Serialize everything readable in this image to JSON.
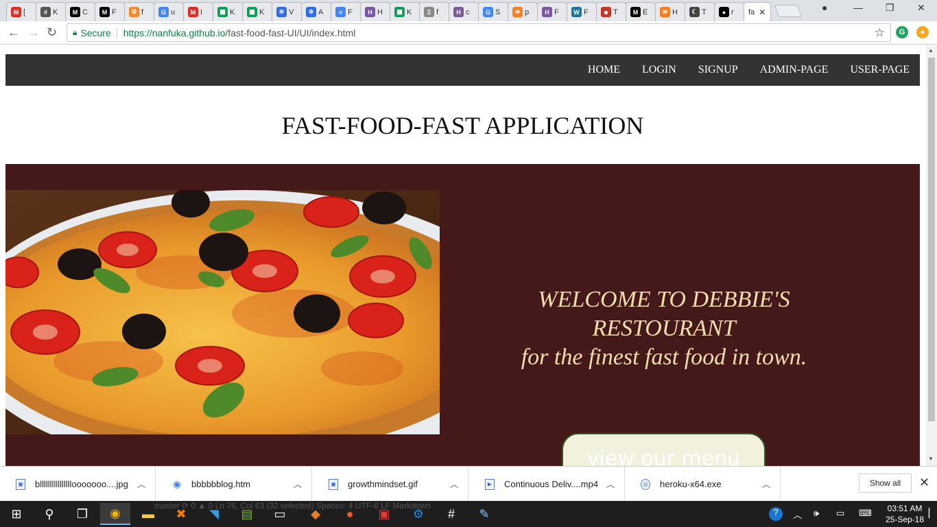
{
  "browser": {
    "tabs": [
      {
        "icon": "gmail-icon",
        "label": "[",
        "color": "#d93025",
        "glyph": "M"
      },
      {
        "icon": "hash-icon",
        "label": "K",
        "color": "#555555",
        "glyph": "#"
      },
      {
        "icon": "medium-icon",
        "label": "C",
        "color": "#000000",
        "glyph": "M"
      },
      {
        "icon": "medium-icon",
        "label": "F",
        "color": "#000000",
        "glyph": "M"
      },
      {
        "icon": "settings-icon",
        "label": "f",
        "color": "#f28b30",
        "glyph": "⚙"
      },
      {
        "icon": "google-icon",
        "label": "u",
        "color": "#4285f4",
        "glyph": "G"
      },
      {
        "icon": "gmail-icon",
        "label": "I",
        "color": "#d93025",
        "glyph": "M"
      },
      {
        "icon": "sheets-icon",
        "label": "K",
        "color": "#0f9d58",
        "glyph": "▦"
      },
      {
        "icon": "sheets-icon",
        "label": "K",
        "color": "#0f9d58",
        "glyph": "▦"
      },
      {
        "icon": "kubernetes-icon",
        "label": "V",
        "color": "#326ce5",
        "glyph": "✲"
      },
      {
        "icon": "kubernetes-icon",
        "label": "A",
        "color": "#326ce5",
        "glyph": "✲"
      },
      {
        "icon": "docs-icon",
        "label": "F",
        "color": "#4285f4",
        "glyph": "≡"
      },
      {
        "icon": "heroku-icon",
        "label": "H",
        "color": "#79589f",
        "glyph": "H"
      },
      {
        "icon": "sheets-icon",
        "label": "K",
        "color": "#0f9d58",
        "glyph": "▦"
      },
      {
        "icon": "page-icon",
        "label": "f",
        "color": "#888888",
        "glyph": "▯"
      },
      {
        "icon": "heroku-icon",
        "label": "c",
        "color": "#79589f",
        "glyph": "H"
      },
      {
        "icon": "google-icon",
        "label": "S",
        "color": "#4285f4",
        "glyph": "G"
      },
      {
        "icon": "stackoverflow-icon",
        "label": "p",
        "color": "#f48024",
        "glyph": "≋"
      },
      {
        "icon": "heroku-icon",
        "label": "F",
        "color": "#79589f",
        "glyph": "H"
      },
      {
        "icon": "wordpress-icon",
        "label": "F",
        "color": "#21759b",
        "glyph": "W"
      },
      {
        "icon": "avatar-icon",
        "label": "T",
        "color": "#c0392b",
        "glyph": "☻"
      },
      {
        "icon": "medium-icon",
        "label": "E",
        "color": "#000000",
        "glyph": "M"
      },
      {
        "icon": "stackoverflow-icon",
        "label": "H",
        "color": "#f48024",
        "glyph": "≋"
      },
      {
        "icon": "moon-icon",
        "label": "T",
        "color": "#444444",
        "glyph": "☾"
      },
      {
        "icon": "github-icon",
        "label": "r",
        "color": "#000000",
        "glyph": "●"
      }
    ],
    "active_tab_label": "fa",
    "address": {
      "secure_label": "Secure",
      "url_main": "https://nanfuka.github.io",
      "url_rest": "/fast-food-fast-UI/UI/index.html"
    }
  },
  "page": {
    "nav": [
      "HOME",
      "LOGIN",
      "SIGNUP",
      "ADMIN-PAGE",
      "USER-PAGE"
    ],
    "title": "FAST-FOOD-FAST APPLICATION",
    "welcome_line1": "WELCOME TO DEBBIE'S RESTOURANT",
    "welcome_line2": "for the finest fast food in town.",
    "menu_button": "view our menu",
    "colors": {
      "navbar": "#333333",
      "hero": "#45181a",
      "welcome_text": "#f3dfae"
    }
  },
  "downloads": {
    "items": [
      "bllllllllllllllllooooooo....jpg",
      "bbbbbblog.htm",
      "growthmindset.gif",
      "Continuous Deliv....mp4",
      "heroku-x64.exe"
    ],
    "show_all": "Show all"
  },
  "taskbar": {
    "status_fragments": "master  ⟳  0 ▲ 0   Ln 76, Col 63 (32 selected)   Spaces: 4   UTF-8   LF   Markdown",
    "time": "03:51 AM",
    "date": "25-Sep-18"
  }
}
